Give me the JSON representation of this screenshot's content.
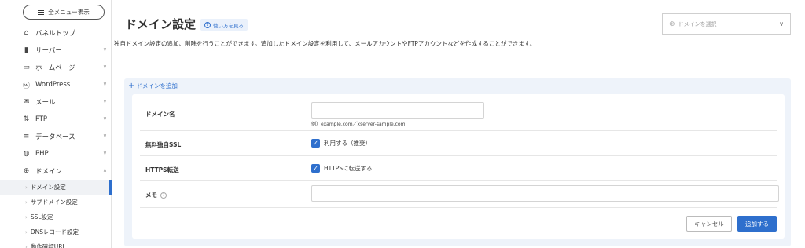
{
  "sidebar": {
    "menu_button": "全メニュー表示",
    "items": [
      {
        "label": "パネルトップ",
        "icon": "home-icon",
        "glyph": "⌂",
        "chevron": false
      },
      {
        "label": "サーバー",
        "icon": "server-icon",
        "glyph": "▮",
        "chevron": true
      },
      {
        "label": "ホームページ",
        "icon": "window-icon",
        "glyph": "▭",
        "chevron": true
      },
      {
        "label": "WordPress",
        "icon": "wordpress-icon",
        "glyph": "ⓦ",
        "chevron": true
      },
      {
        "label": "メール",
        "icon": "mail-icon",
        "glyph": "✉",
        "chevron": true
      },
      {
        "label": "FTP",
        "icon": "ftp-icon",
        "glyph": "⇅",
        "chevron": true
      },
      {
        "label": "データベース",
        "icon": "database-icon",
        "glyph": "≡",
        "chevron": true
      },
      {
        "label": "PHP",
        "icon": "php-icon",
        "glyph": "◍",
        "chevron": true
      },
      {
        "label": "ドメイン",
        "icon": "globe-icon",
        "glyph": "⊕",
        "chevron": true,
        "expanded": true
      }
    ],
    "sub_items": [
      "ドメイン設定",
      "サブドメイン設定",
      "SSL設定",
      "DNSレコード設定",
      "動作確認URL"
    ]
  },
  "header": {
    "title": "ドメイン設定",
    "help_label": "使い方を見る",
    "domain_select_placeholder": "ドメインを選択",
    "description": "独自ドメイン設定の追加、削除を行うことができます。追加したドメイン設定を利用して、メールアカウントやFTPアカウントなどを作成することができます。"
  },
  "form": {
    "add_link": "ドメインを追加",
    "domain_label": "ドメイン名",
    "domain_value": "",
    "domain_example": "例）example.com／xserver-sample.com",
    "ssl_label": "無料独自SSL",
    "ssl_option": "利用する（推奨）",
    "ssl_checked": true,
    "https_label": "HTTPS転送",
    "https_option": "HTTPSに転送する",
    "https_checked": true,
    "memo_label": "メモ",
    "memo_value": "",
    "cancel": "キャンセル",
    "submit": "追加する"
  },
  "colors": {
    "accent": "#2e6fcd",
    "panel_bg": "#eef3fa"
  }
}
